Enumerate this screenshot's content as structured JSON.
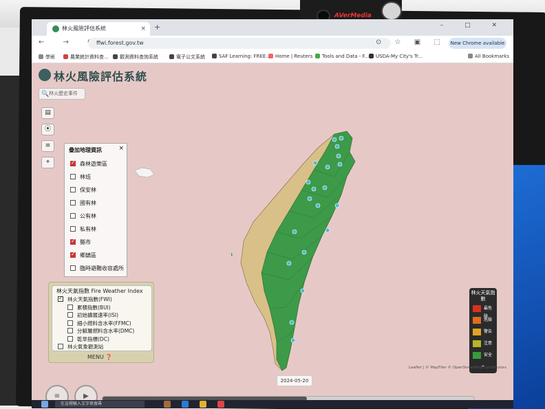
{
  "webcam": {
    "brand": "AVerMedia"
  },
  "browser": {
    "tab_title": "林火風險評估系統",
    "tab_close": "×",
    "new_tab": "+",
    "window_controls": "–  □  ✕",
    "nav_buttons": "←  →  C",
    "url": "ffwi.forest.gov.tw",
    "address_icons": "⊙ ☆ ▣ ⬚",
    "chrome_button": "New Chrome available",
    "bookmarks": [
      "學術",
      "農業統計資料查...",
      "觀測資料查詢系統",
      "電子公文系統",
      "SAF Learning: FREE...",
      "Home | Reuters",
      "Tools and Data - F...",
      "USDA-My City's Tr..."
    ],
    "all_bookmarks": "All Bookmarks"
  },
  "app": {
    "title": "林火風險評估系統",
    "search_label": "林火歷史事件",
    "search_icon": "🔍",
    "tools": [
      "▤",
      "⦿",
      "≡",
      "⌖"
    ]
  },
  "layers_panel": {
    "title": "疊加地理資訊",
    "close": "×",
    "items": [
      {
        "label": "森林遊樂區",
        "checked": true
      },
      {
        "label": "林班",
        "checked": false
      },
      {
        "label": "保安林",
        "checked": false
      },
      {
        "label": "國有林",
        "checked": false
      },
      {
        "label": "公有林",
        "checked": false
      },
      {
        "label": "私有林",
        "checked": false
      },
      {
        "label": "縣市",
        "checked": true
      },
      {
        "label": "鄉鎮區",
        "checked": true
      },
      {
        "label": "臨時避難收容處所",
        "checked": false
      }
    ]
  },
  "fwi_panel": {
    "title": "林火天氣指數 Fire Weather Index",
    "items": [
      {
        "label": "林火天氣指數(FWI)",
        "checked": true,
        "indent": false
      },
      {
        "label": "累積指數(BUI)",
        "checked": false,
        "indent": true
      },
      {
        "label": "初始擴展速率(ISI)",
        "checked": false,
        "indent": true
      },
      {
        "label": "細小燃料含水率(FFMC)",
        "checked": false,
        "indent": true
      },
      {
        "label": "分解層燃料含水率(DMC)",
        "checked": false,
        "indent": true
      },
      {
        "label": "乾旱指標(DC)",
        "checked": false,
        "indent": true
      },
      {
        "label": "林火氣象觀測站",
        "checked": false,
        "indent": false
      }
    ],
    "menu_label": "MENU ❓"
  },
  "legend": {
    "title": "林火天氣指數",
    "items": [
      {
        "label": "最危險",
        "color": "#d8321d"
      },
      {
        "label": "危險",
        "color": "#e46a1e"
      },
      {
        "label": "警告",
        "color": "#e3a51f"
      },
      {
        "label": "注意",
        "color": "#b7b52a"
      },
      {
        "label": "安全",
        "color": "#3a9a3a"
      }
    ],
    "collapse": "^"
  },
  "timeline": {
    "date": "2024-05-20",
    "menu_icon": "≡",
    "play_icon": "▶",
    "progress": 0.55
  },
  "attribution": "Leaflet | © MapTiler © OpenStreetMap contributors",
  "taskbar": {
    "search_placeholder": "在這裡輸入文字來搜尋"
  },
  "colors": {
    "page_bg": "#e6c9c7",
    "map_green": "#3c9a48",
    "accent": "#2f4f4f"
  }
}
